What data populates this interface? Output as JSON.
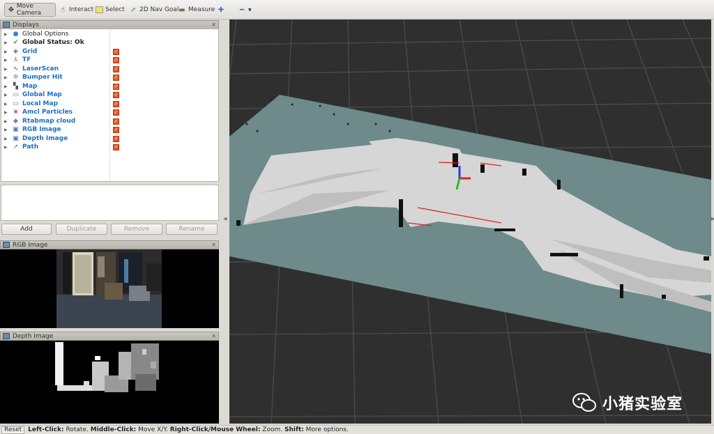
{
  "toolbar": {
    "tools": [
      {
        "label": "Move Camera",
        "icon": "move-camera-icon"
      },
      {
        "label": "Interact",
        "icon": "interact-icon"
      },
      {
        "label": "Select",
        "icon": "select-icon"
      },
      {
        "label": "2D Nav Goal",
        "icon": "nav-goal-icon"
      },
      {
        "label": "Measure",
        "icon": "measure-icon"
      }
    ]
  },
  "displays": {
    "title": "Displays",
    "items": [
      {
        "label": "Global Options",
        "style": "plain",
        "checked": false
      },
      {
        "label": "Global Status: Ok",
        "style": "bold",
        "checked": false
      },
      {
        "label": "Grid",
        "style": "link",
        "checked": true
      },
      {
        "label": "TF",
        "style": "link",
        "checked": true
      },
      {
        "label": "LaserScan",
        "style": "link",
        "checked": true
      },
      {
        "label": "Bumper Hit",
        "style": "link",
        "checked": true
      },
      {
        "label": "Map",
        "style": "link",
        "checked": true
      },
      {
        "label": "Global Map",
        "style": "link",
        "checked": true
      },
      {
        "label": "Local Map",
        "style": "link",
        "checked": true
      },
      {
        "label": "Amcl Particles",
        "style": "link",
        "checked": true
      },
      {
        "label": "Rtabmap cloud",
        "style": "link",
        "checked": true
      },
      {
        "label": "RGB Image",
        "style": "link",
        "checked": true
      },
      {
        "label": "Depth Image",
        "style": "link",
        "checked": true
      },
      {
        "label": "Path",
        "style": "link",
        "checked": true
      }
    ],
    "buttons": {
      "add": "Add",
      "duplicate": "Duplicate",
      "remove": "Remove",
      "rename": "Rename"
    }
  },
  "rgb_panel": {
    "title": "RGB Image"
  },
  "depth_panel": {
    "title": "Depth Image"
  },
  "status_bar": {
    "reset": "Reset",
    "left_click_key": "Left-Click:",
    "left_click_val": "Rotate.",
    "middle_click_key": "Middle-Click:",
    "middle_click_val": "Move X/Y.",
    "right_click_key": "Right-Click/Mouse Wheel:",
    "right_click_val": "Zoom.",
    "shift_key": "Shift:",
    "shift_val": "More options."
  },
  "watermark": {
    "text": "小猪实验室"
  },
  "colors": {
    "link": "#1d6fc2",
    "check": "#e8582a",
    "floor": "#6f8b8c",
    "grid_bg": "#303030"
  }
}
